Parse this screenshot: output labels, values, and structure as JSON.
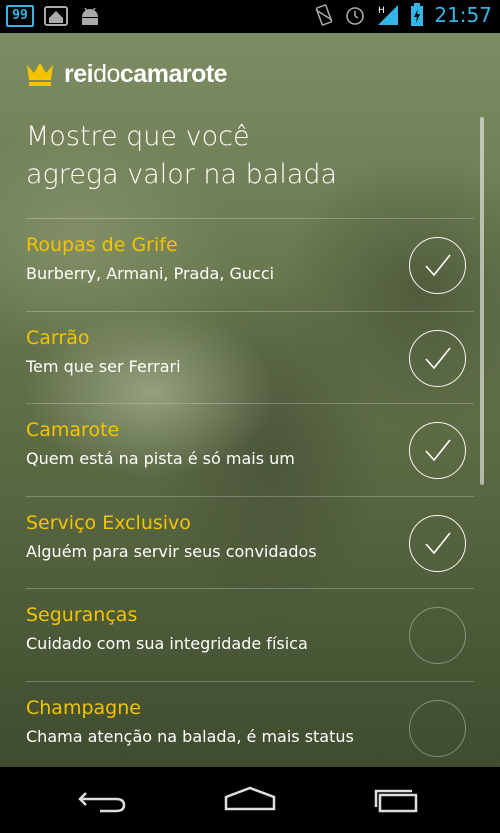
{
  "status_bar": {
    "notification_count": "99",
    "time": "21:57",
    "icons": [
      "notification-count",
      "home-app-icon",
      "android-icon",
      "vibrate-icon",
      "alarm-icon",
      "signal-icon",
      "battery-icon"
    ]
  },
  "app": {
    "brand": {
      "rei": "rei",
      "do": "do",
      "camarote": "camarote",
      "logo_icon": "crown-icon"
    },
    "headline": {
      "line1": "Mostre que você",
      "line2": "agrega valor na balada"
    },
    "accent_color": "#f5c400",
    "items": [
      {
        "title": "Roupas de Grife",
        "subtitle": "Burberry, Armani, Prada, Gucci",
        "checked": true
      },
      {
        "title": "Carrão",
        "subtitle": "Tem que ser Ferrari",
        "checked": true
      },
      {
        "title": "Camarote",
        "subtitle": "Quem está na pista é só mais um",
        "checked": true
      },
      {
        "title": "Serviço Exclusivo",
        "subtitle": "Alguém para servir seus convidados",
        "checked": true
      },
      {
        "title": "Seguranças",
        "subtitle": "Cuidado com sua integridade física",
        "checked": false
      },
      {
        "title": "Champagne",
        "subtitle": "Chama atenção na balada, é mais status",
        "checked": false
      }
    ]
  },
  "nav_bar": {
    "icons": [
      "back-icon",
      "home-icon",
      "recent-apps-icon"
    ]
  }
}
